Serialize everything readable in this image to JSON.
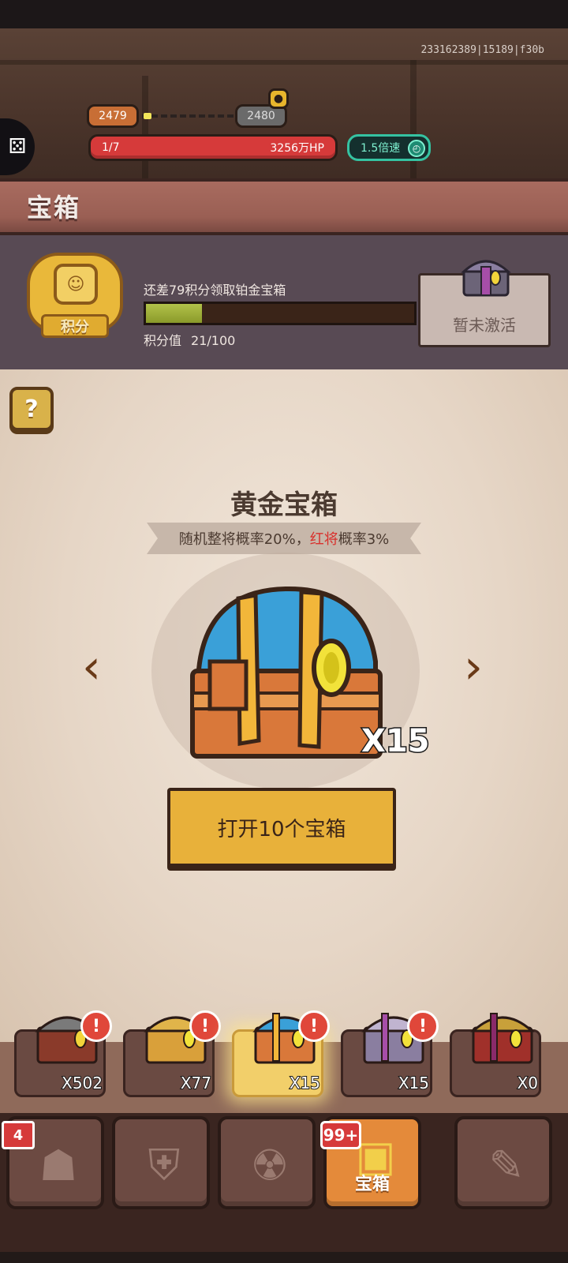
{
  "header": {
    "game_id": "233162389|15189|f30b",
    "level_current": "2479",
    "level_next": "2480",
    "wave": "1/7",
    "boss_hp": "3256万HP",
    "speed_label": "1.5倍速"
  },
  "page_title": "宝箱",
  "points": {
    "badge_label": "积分",
    "message": "还差79积分领取铂金宝箱",
    "value_label": "积分值",
    "value_text": "21/100",
    "progress": 0.21,
    "platinum_status": "暂未激活"
  },
  "chest": {
    "name": "黄金宝箱",
    "desc_prefix": "随机整将概率20%，",
    "desc_red": "红将",
    "desc_suffix": "概率3%",
    "count": "X15",
    "open_button": "打开10个宝箱"
  },
  "chest_slots": [
    {
      "count": "X502",
      "alert": "!",
      "selected": false
    },
    {
      "count": "X77",
      "alert": "!",
      "selected": false
    },
    {
      "count": "X15",
      "alert": "!",
      "selected": true
    },
    {
      "count": "X15",
      "alert": "!",
      "selected": false
    },
    {
      "count": "X0",
      "alert": "",
      "selected": false
    }
  ],
  "nav": {
    "badge_first": "4",
    "badge_chest": "99+",
    "active_label": "宝箱"
  },
  "colors": {
    "hp_red": "#d63a3a",
    "speed_teal": "#35c3a2",
    "gold": "#e8b13a",
    "accent_red_text": "#d9302c"
  }
}
